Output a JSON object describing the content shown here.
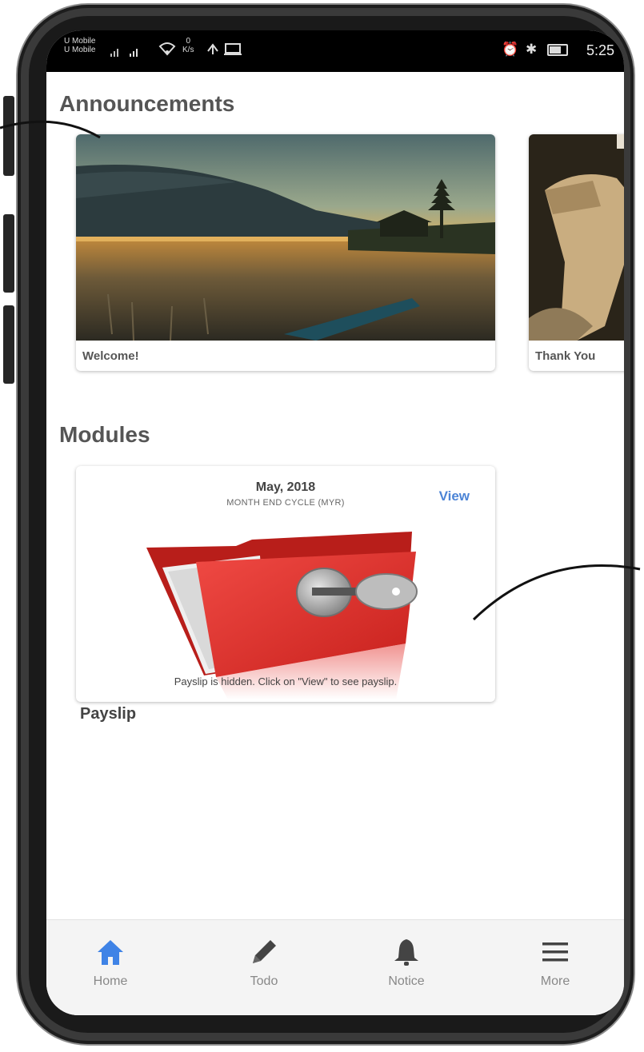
{
  "status_bar": {
    "carrier_1": "U Mobile",
    "carrier_2": "U Mobile",
    "net_speed": "0",
    "net_unit": "K/s",
    "time": "5:25",
    "battery": "56"
  },
  "announcements": {
    "title": "Announcements",
    "cards": [
      {
        "caption": "Welcome!"
      },
      {
        "caption": "Thank You"
      }
    ]
  },
  "modules": {
    "title": "Modules",
    "payslip_card": {
      "date": "May, 2018",
      "cycle": "MONTH END CYCLE (MYR)",
      "view_label": "View",
      "message": "Payslip is hidden. Click on \"View\" to see payslip.",
      "label": "Payslip"
    }
  },
  "bottom_nav": {
    "items": [
      {
        "label": "Home",
        "icon": "home-icon",
        "active": true
      },
      {
        "label": "Todo",
        "icon": "pencil-icon",
        "active": false
      },
      {
        "label": "Notice",
        "icon": "bell-icon",
        "active": false
      },
      {
        "label": "More",
        "icon": "menu-icon",
        "active": false
      }
    ]
  },
  "colors": {
    "accent": "#4c84d6",
    "heading": "#555555",
    "folder_red": "#e53a36"
  }
}
